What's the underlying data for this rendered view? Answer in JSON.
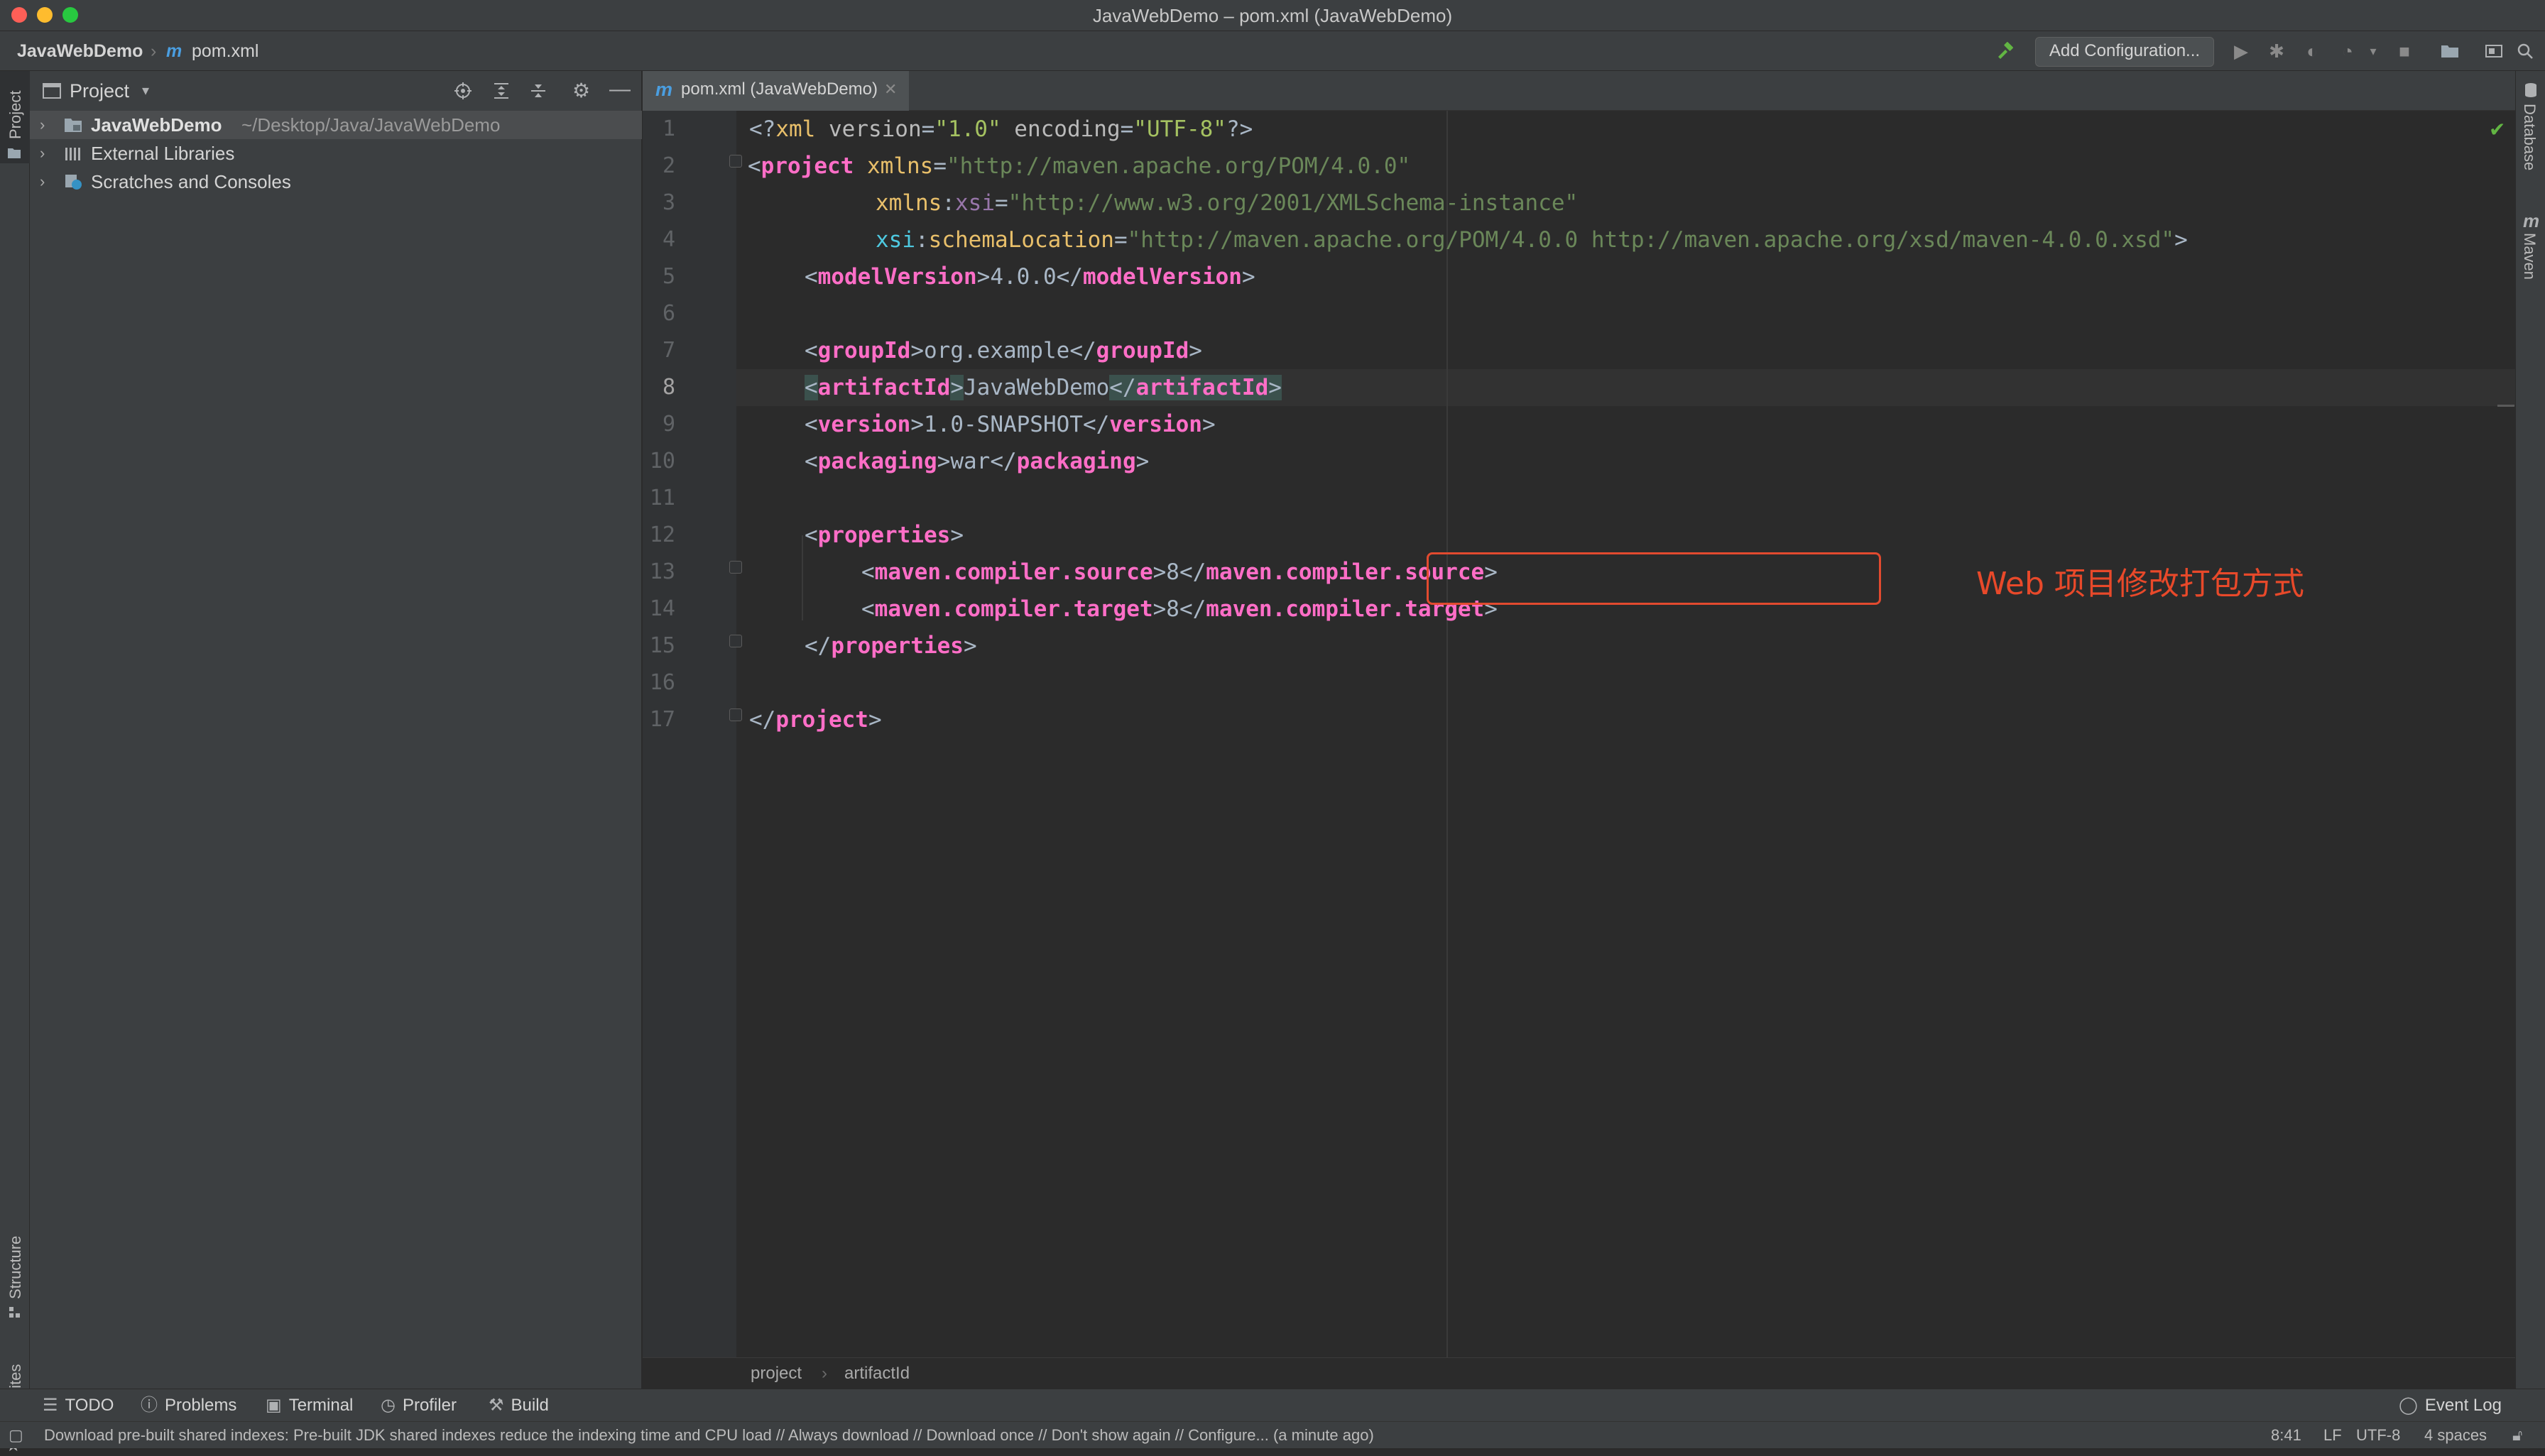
{
  "window": {
    "title": "JavaWebDemo – pom.xml (JavaWebDemo)"
  },
  "nav": {
    "project": "JavaWebDemo",
    "file": "pom.xml",
    "add_config": "Add Configuration..."
  },
  "left_strip": {
    "project": "Project",
    "structure": "Structure",
    "favorites": "Favorites"
  },
  "right_strip": {
    "database": "Database",
    "maven": "Maven"
  },
  "project_panel": {
    "title": "Project",
    "items": [
      {
        "label": "JavaWebDemo",
        "path": "~/Desktop/Java/JavaWebDemo"
      },
      {
        "label": "External Libraries"
      },
      {
        "label": "Scratches and Consoles"
      }
    ]
  },
  "editor": {
    "tab": "pom.xml (JavaWebDemo)",
    "line_numbers": [
      "1",
      "2",
      "3",
      "4",
      "5",
      "6",
      "7",
      "8",
      "9",
      "10",
      "11",
      "12",
      "13",
      "14",
      "15",
      "16",
      "17"
    ],
    "annotation": "Web 项目修改打包方式",
    "l1": {
      "a": "<?",
      "b": "xml",
      "c": " version",
      "d": "=",
      "e": "\"1.0\"",
      "f": " encoding",
      "g": "=",
      "h": "\"UTF-8\"",
      "i": "?>"
    },
    "l2": {
      "a": "<",
      "b": "project",
      "c": " xmlns",
      "d": "=",
      "e": "\"http://maven.apache.org/POM/4.0.0\""
    },
    "l3": {
      "a": "xmlns",
      "b": ":",
      "c": "xsi",
      "d": "=",
      "e": "\"http://www.w3.org/2001/XMLSchema-instance\""
    },
    "l4": {
      "a": "xsi",
      "b": ":",
      "c": "schemaLocation",
      "d": "=",
      "e": "\"http://maven.apache.org/POM/4.0.0 http://maven.apache.org/xsd/maven-4.0.0.xsd\"",
      "f": ">"
    },
    "l5": {
      "tag": "modelVersion",
      "value": "4.0.0"
    },
    "l7": {
      "tag": "groupId",
      "value": "org.example"
    },
    "l8": {
      "tag": "artifactId",
      "value": "JavaWebDemo"
    },
    "l9": {
      "tag": "version",
      "value": "1.0-SNAPSHOT"
    },
    "l10": {
      "tag": "packaging",
      "value": "war"
    },
    "l12": {
      "tag": "properties"
    },
    "l13": {
      "tag": "maven.compiler.source",
      "value": "8"
    },
    "l14": {
      "tag": "maven.compiler.target",
      "value": "8"
    },
    "l15": {
      "tag": "properties"
    },
    "l17": {
      "tag": "project"
    },
    "lt": "<",
    "gt": ">",
    "lts": "</"
  },
  "code_breadcrumb": {
    "a": "project",
    "sep": "›",
    "b": "artifactId"
  },
  "tool_windows": {
    "todo": "TODO",
    "problems": "Problems",
    "terminal": "Terminal",
    "profiler": "Profiler",
    "build": "Build",
    "event_log": "Event Log"
  },
  "status": {
    "message": "Download pre-built shared indexes: Pre-built JDK shared indexes reduce the indexing time and CPU load // Always download // Download once // Don't show again // Configure... (a minute ago)",
    "position": "8:41",
    "line_sep": "LF",
    "encoding": "UTF-8",
    "indent": "4 spaces"
  },
  "colors": {
    "accent": "#4a88c7",
    "annotation": "#e8492a",
    "xml_tag": "#ff6ec7",
    "string": "#6a8759"
  }
}
